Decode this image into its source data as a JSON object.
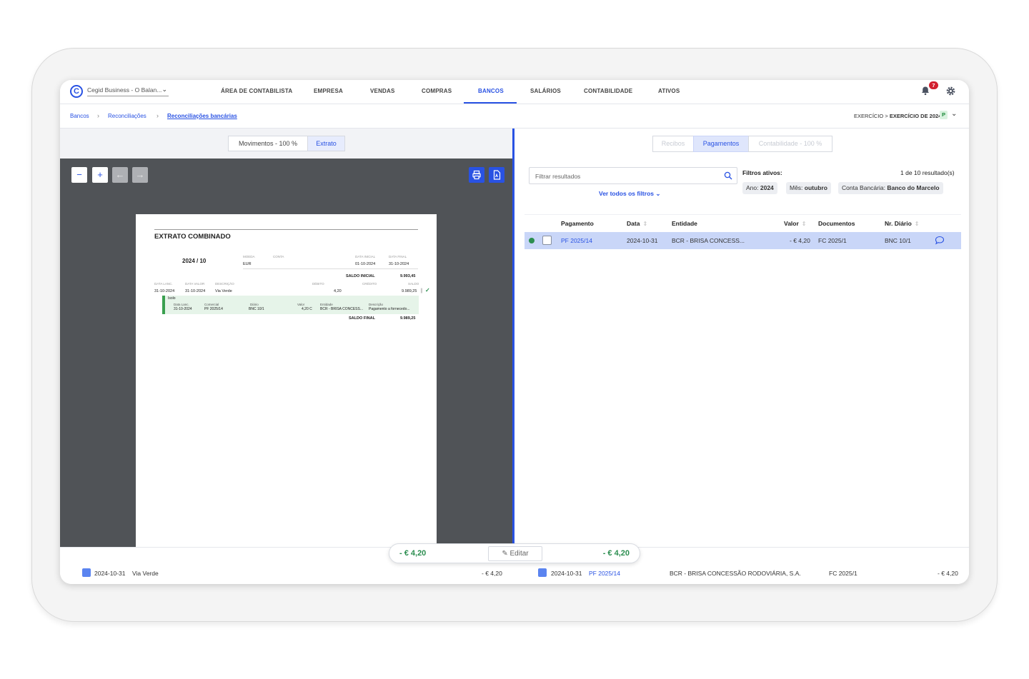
{
  "company": {
    "name": "Cegid Business - O Balan..."
  },
  "nav": {
    "items": [
      "ÁREA DE CONTABILISTA",
      "EMPRESA",
      "VENDAS",
      "COMPRAS",
      "BANCOS",
      "SALÁRIOS",
      "CONTABILIDADE",
      "ATIVOS"
    ],
    "active": "BANCOS",
    "notifications": "7"
  },
  "breadcrumb": {
    "items": [
      "Bancos",
      "Reconciliações",
      "Reconciliações bancárias"
    ]
  },
  "exercicio": {
    "prefix": "EXERCÍCIO > ",
    "value": "EXERCÍCIO DE 2024",
    "badge": "P"
  },
  "left": {
    "segments": [
      "Movimentos - 100 %",
      "Extrato"
    ],
    "active_segment": "Extrato",
    "statement": {
      "title": "EXTRATO COMBINADO",
      "period": "2024 / 10",
      "hdr_moeda": "MOEDA",
      "hdr_conta": "CONTA",
      "hdr_data_inicial": "DATA INICIAL",
      "hdr_data_final": "DATA FINAL",
      "moeda": "EUR",
      "data_inicial": "01-10-2024",
      "data_final": "31-10-2024",
      "saldo_inicial_label": "SALDO INICIAL",
      "saldo_inicial": "9.993,45",
      "col_data_lanc": "DATA LANC.",
      "col_data_valor": "DATA VALOR",
      "col_descricao": "DESCRIÇÃO",
      "col_debito": "DÉBITO",
      "col_credito": "CRÉDITO",
      "col_saldo": "SALDO",
      "line_data_lanc": "31-10-2024",
      "line_data_valor": "31-10-2024",
      "line_desc": "Via Verde",
      "line_debito": "4,20",
      "line_saldo": "9.989,25",
      "sub_header": "Isolo",
      "sub_cols": [
        "Data Lanc.",
        "Comercial",
        "Diário",
        "Valor",
        "Entidade",
        "Descrição"
      ],
      "sub_vals": [
        "31-10-2024",
        "PF 2025/14",
        "BNC 10/1",
        "4,20 C",
        "BCR - BRISA CONCESS...",
        "Pagamento a fornecedo..."
      ],
      "saldo_final_label": "SALDO FINAL",
      "saldo_final": "9.989,25"
    }
  },
  "right": {
    "tabs": [
      "Recibos",
      "Pagamentos",
      "Contabilidade - 100 %"
    ],
    "active_tab": "Pagamentos",
    "filter_placeholder": "Filtrar resultados",
    "ver_filtros": "Ver todos os filtros",
    "filtros_label": "Filtros ativos:",
    "result_count": "1 de 10 resultado(s)",
    "chips": [
      {
        "label": "Ano: ",
        "value": "2024"
      },
      {
        "label": "Mês: ",
        "value": "outubro"
      },
      {
        "label": "Conta Bancária: ",
        "value": "Banco do Marcelo"
      }
    ],
    "columns": [
      "Pagamento",
      "Data",
      "Entidade",
      "Valor",
      "Documentos",
      "Nr. Diário"
    ],
    "rows": [
      {
        "pagamento": "PF 2025/14",
        "data": "2024-10-31",
        "entidade": "BCR - BRISA CONCESS...",
        "valor": "- € 4,20",
        "documentos": "FC 2025/1",
        "diario": "BNC 10/1"
      }
    ]
  },
  "summary": {
    "left_total": "- € 4,20",
    "right_total": "- € 4,20",
    "edit_label": "Editar"
  },
  "bottom": {
    "left": {
      "date": "2024-10-31",
      "desc": "Via Verde",
      "amount": "- € 4,20"
    },
    "right": {
      "date": "2024-10-31",
      "ref": "PF 2025/14",
      "entity": "BCR - BRISA CONCESSÃO RODOVIÁRIA, S.A.",
      "doc": "FC 2025/1",
      "amount": "- € 4,20"
    }
  },
  "colors": {
    "accent": "#2952e3",
    "positive": "#2c8e50",
    "selected_row": "#c9d6f8"
  }
}
